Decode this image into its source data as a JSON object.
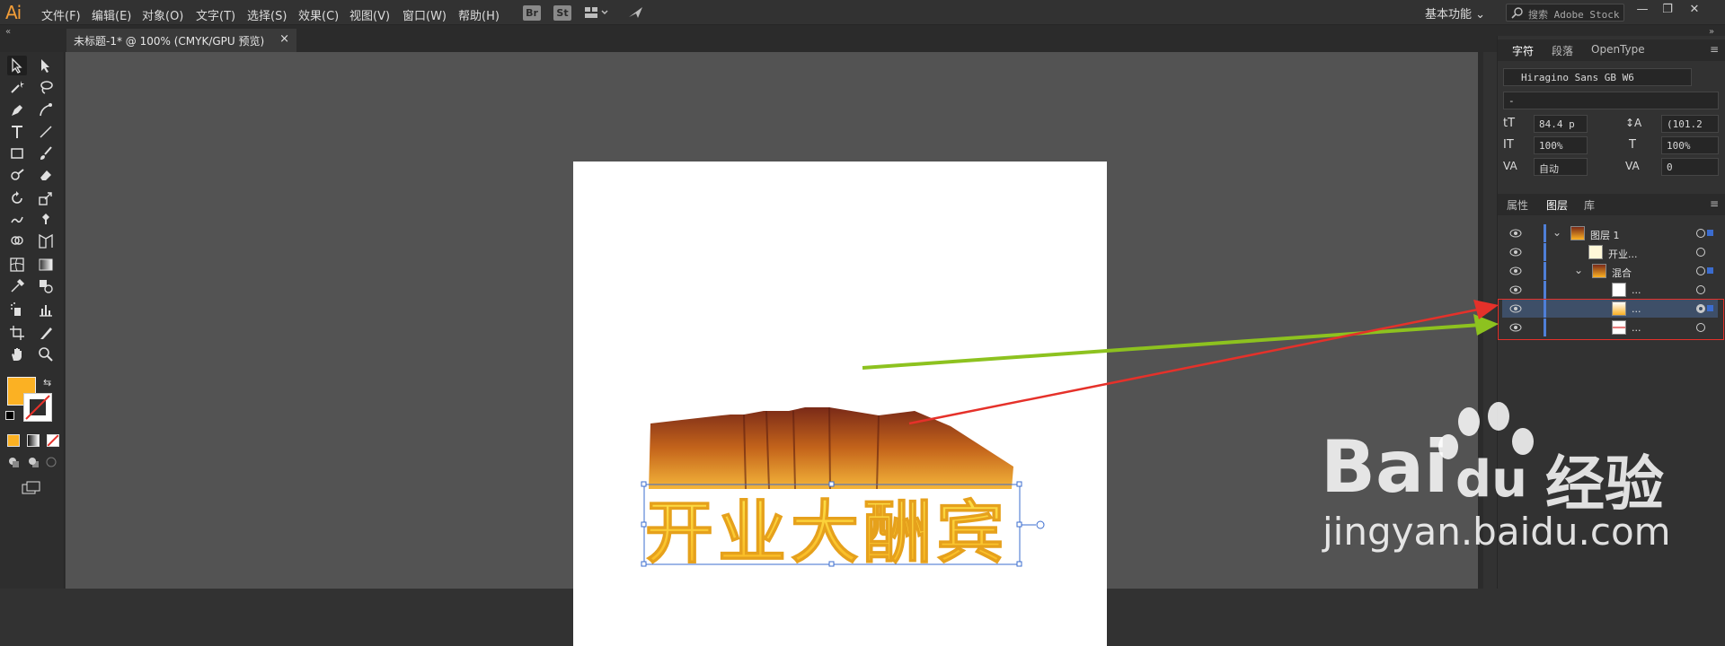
{
  "app": {
    "logo": "Ai"
  },
  "menu": [
    {
      "label": "文件(F)"
    },
    {
      "label": "编辑(E)"
    },
    {
      "label": "对象(O)"
    },
    {
      "label": "文字(T)"
    },
    {
      "label": "选择(S)"
    },
    {
      "label": "效果(C)"
    },
    {
      "label": "视图(V)"
    },
    {
      "label": "窗口(W)"
    },
    {
      "label": "帮助(H)"
    }
  ],
  "toolbar_top": {
    "br": "Br",
    "st": "St"
  },
  "workspace": {
    "label": "基本功能"
  },
  "search": {
    "placeholder": "搜索 Adobe Stock"
  },
  "document": {
    "tab_title": "未标题-1* @ 100% (CMYK/GPU 预览)",
    "close": "×"
  },
  "artwork": {
    "text": "开业大酬宾"
  },
  "character_panel": {
    "tabs": [
      "字符",
      "段落",
      "OpenType"
    ],
    "font_family": "Hiragino Sans GB W6",
    "font_style": "-",
    "font_size": "84.4 p",
    "leading": "(101.2",
    "vertical_scale": "100%",
    "horizontal_scale": "100%",
    "kerning": "自动",
    "tracking": "0"
  },
  "layers_panel": {
    "tabs": [
      "属性",
      "图层",
      "库"
    ],
    "rows": [
      {
        "name": "图层 1"
      },
      {
        "name": "开业..."
      },
      {
        "name": "混合"
      },
      {
        "name": "..."
      },
      {
        "name": "..."
      },
      {
        "name": "..."
      }
    ]
  },
  "watermark": {
    "brand_prefix": "Bai",
    "brand_suffix": "经验",
    "url": "jingyan.baidu.com"
  },
  "colors": {
    "accent": "#f29d38",
    "fill": "#fbb123",
    "selection": "#3b6ccf",
    "annotation_red": "#e5312a",
    "annotation_green": "#8dc21f"
  }
}
